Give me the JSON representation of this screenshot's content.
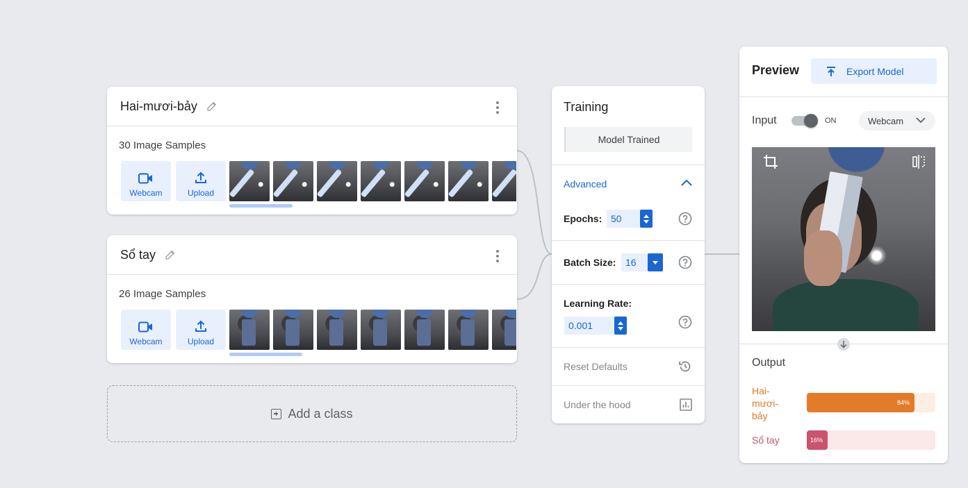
{
  "classes": [
    {
      "name": "Hai-mươi-bảy",
      "samples_label": "30 Image Samples",
      "webcam_label": "Webcam",
      "upload_label": "Upload"
    },
    {
      "name": "Sổ tay",
      "samples_label": "26 Image Samples",
      "webcam_label": "Webcam",
      "upload_label": "Upload"
    }
  ],
  "add_class_label": "Add a class",
  "training": {
    "title": "Training",
    "status_button": "Model Trained",
    "advanced_label": "Advanced",
    "epochs_label": "Epochs:",
    "epochs_value": "50",
    "batch_label": "Batch Size:",
    "batch_value": "16",
    "lr_label": "Learning Rate:",
    "lr_value": "0.001",
    "reset_label": "Reset Defaults",
    "hood_label": "Under the hood"
  },
  "preview": {
    "title": "Preview",
    "export_label": "Export Model",
    "input_label": "Input",
    "toggle_state": "ON",
    "source_select": "Webcam",
    "output_label": "Output",
    "outputs": [
      {
        "label": "Hai-mươi-bảy",
        "display_lines": [
          "Hai-",
          "mươi-",
          "bảy"
        ],
        "percent_text": "84%",
        "fraction": 0.84,
        "color": "#e37b2a",
        "track_color": "#fdeee4"
      },
      {
        "label": "Sổ tay",
        "percent_text": "16%",
        "fraction": 0.16,
        "color": "#c9546b",
        "track_color": "#fbe8e9"
      }
    ]
  },
  "colors": {
    "accent": "#1967d2",
    "background": "#e8eaed"
  }
}
